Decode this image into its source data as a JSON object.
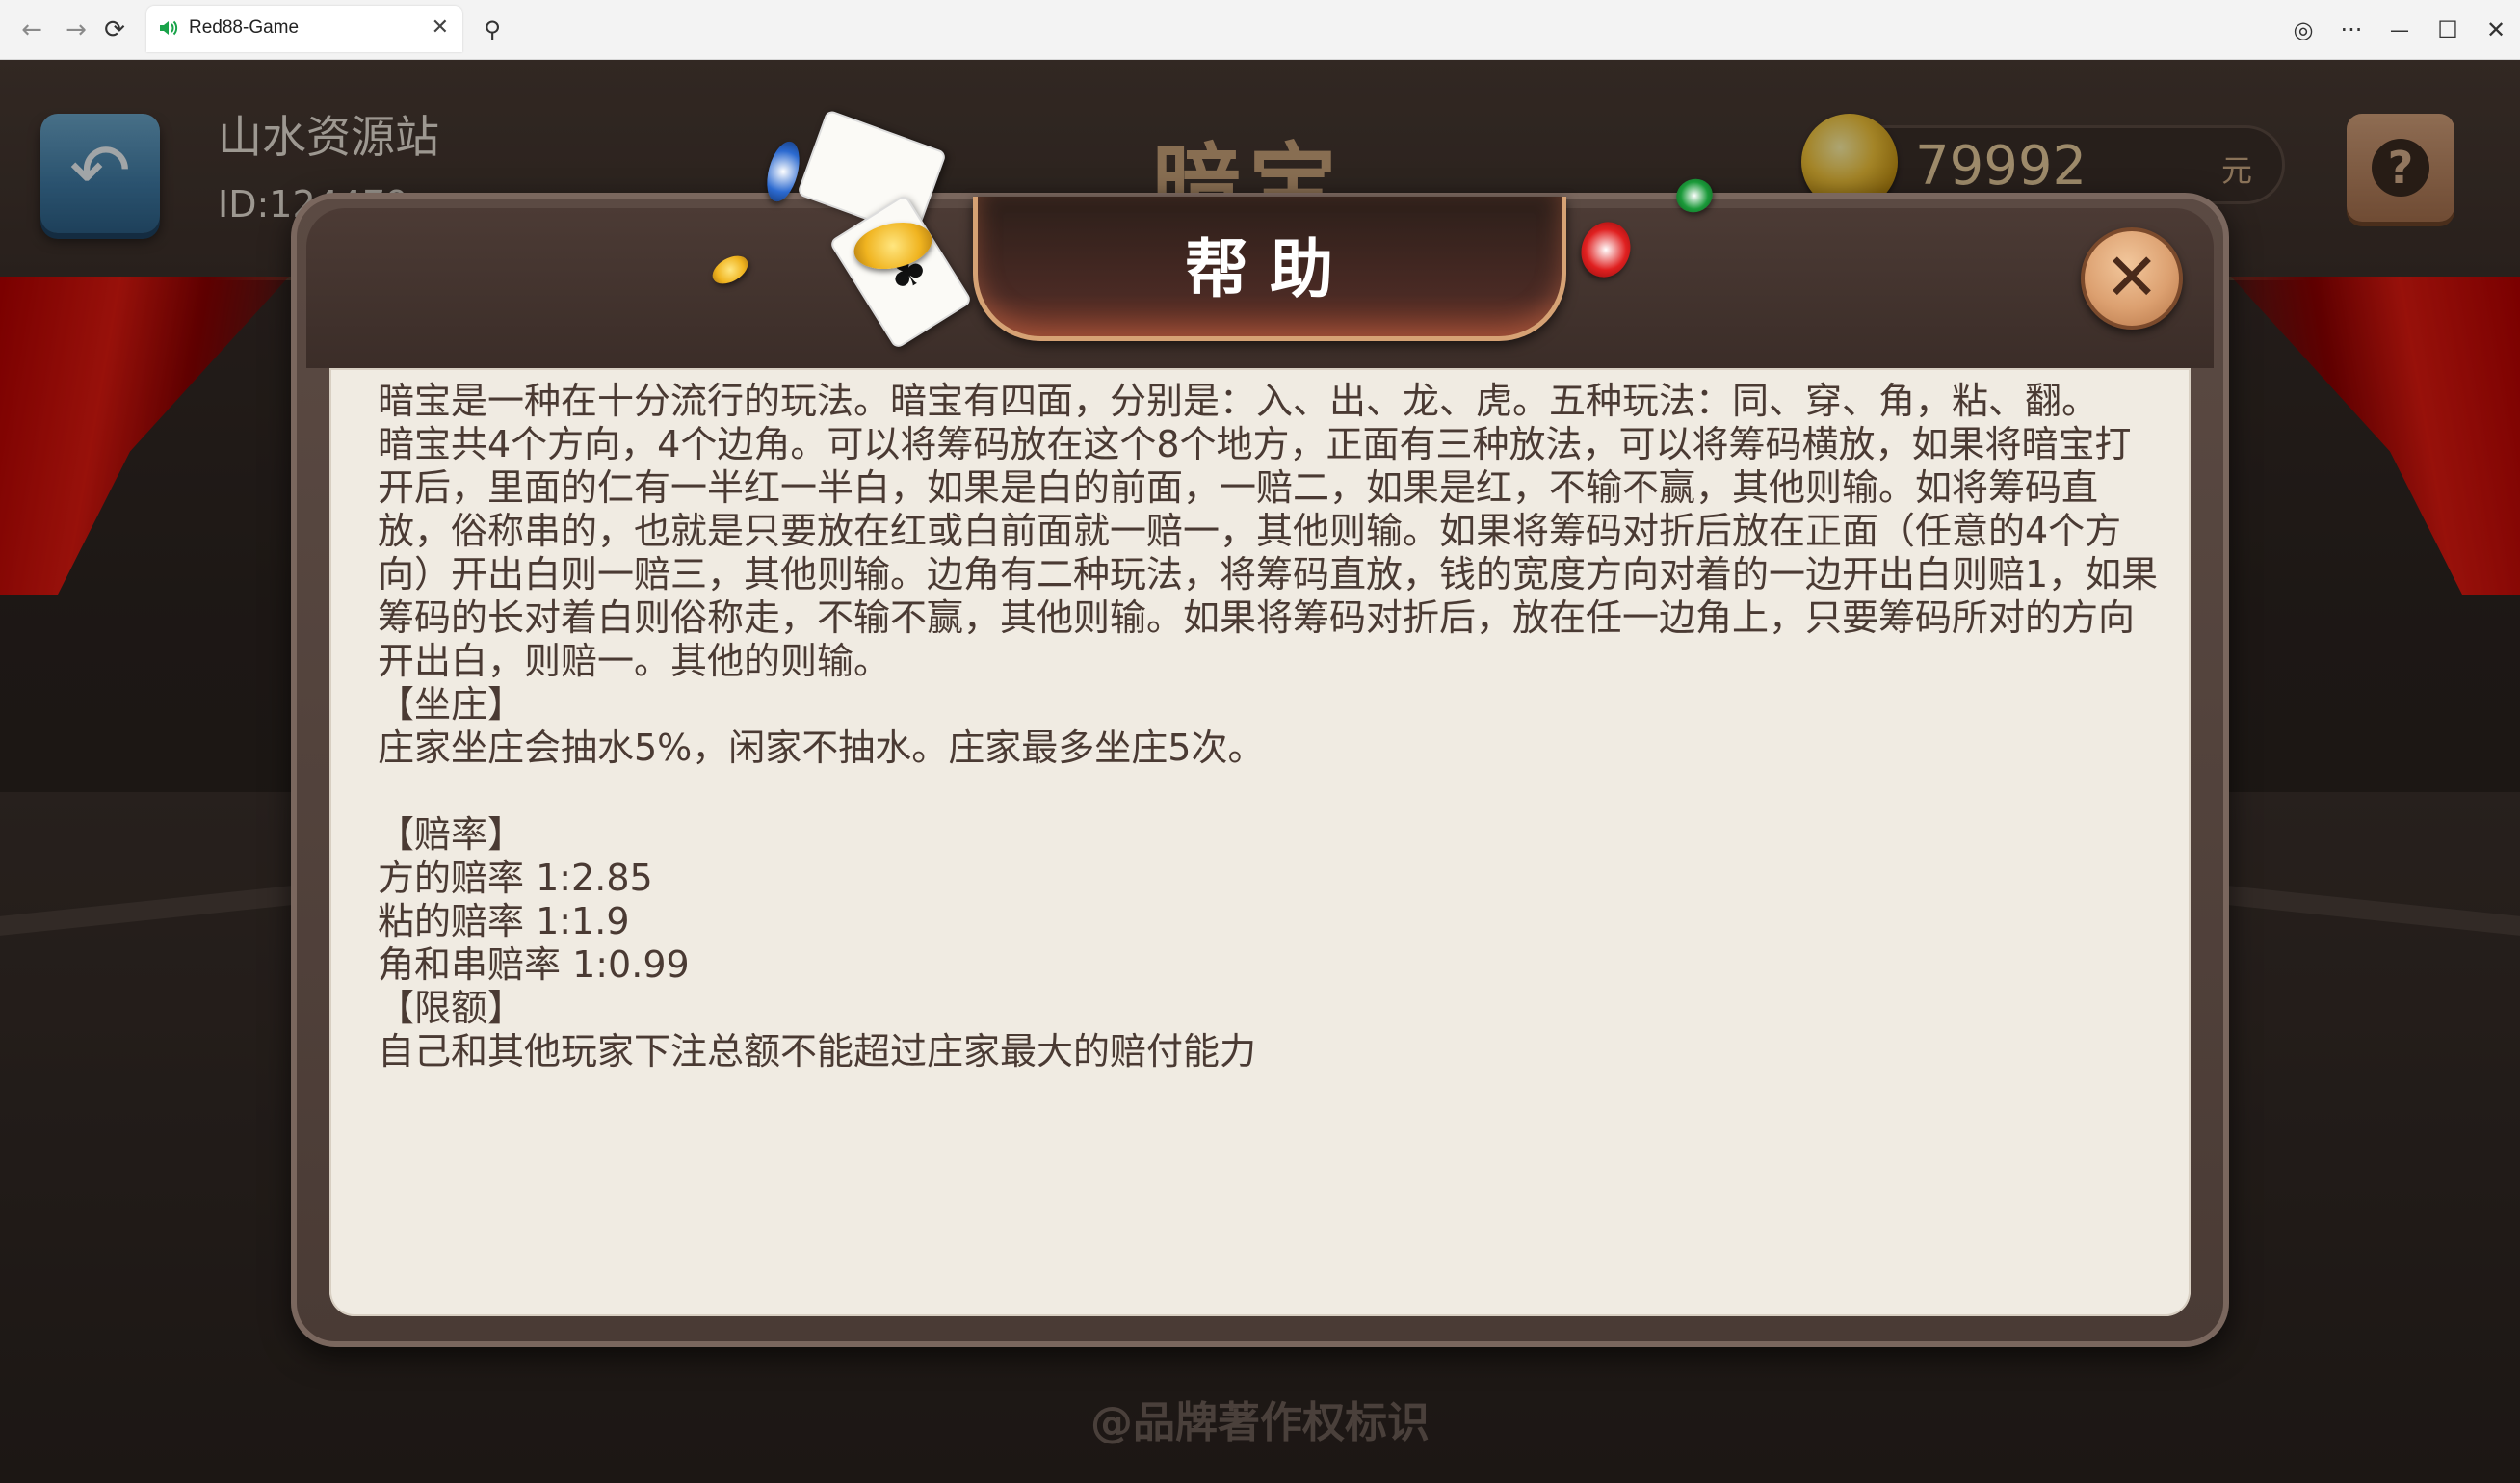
{
  "browser": {
    "tab_title": "Red88-Game",
    "back_glyph": "←",
    "forward_glyph": "→",
    "reload_glyph": "⟳",
    "search_glyph": "⚲",
    "close_tab_glyph": "✕",
    "globe_glyph": "◎",
    "more_glyph": "···",
    "minimize_glyph": "—",
    "maximize_glyph": "☐",
    "close_window_glyph": "✕"
  },
  "header": {
    "user_name": "山水资源站",
    "user_id": "ID:124479",
    "game_title": "暗宝",
    "coins": "79992",
    "coin_unit": "元",
    "back_icon": "undo-arrow-icon",
    "help_icon": "question-mark-icon"
  },
  "dialog": {
    "title": "帮助",
    "close_icon": "close-icon",
    "lines": [
      "暗宝是一种在十分流行的玩法。暗宝有四面，分别是：入、出、龙、虎。五种玩法：同、穿、角，粘、翻。",
      "暗宝共4个方向，4个边角。可以将筹码放在这个8个地方，正面有三种放法，可以将筹码横放，如果将暗宝打开后，里面的仁有一半红一半白，如果是白的前面，一赔二，如果是红，不输不赢，其他则输。如将筹码直放，俗称串的，也就是只要放在红或白前面就一赔一，其他则输。如果将筹码对折后放在正面（任意的4个方向）开出白则一赔三，其他则输。边角有二种玩法，将筹码直放，钱的宽度方向对着的一边开出白则赔1，如果筹码的长对着白则俗称走，不输不赢，其他则输。如果将筹码对折后，放在任一边角上，只要筹码所对的方向开出白，则赔一。其他的则输。",
      "【坐庄】",
      "庄家坐庄会抽水5%，闲家不抽水。庄家最多坐庄5次。",
      "",
      "【赔率】",
      "方的赔率 1:2.85",
      "粘的赔率 1:1.9",
      "角和串赔率 1:0.99",
      "【限额】",
      "自己和其他玩家下注总额不能超过庄家最大的赔付能力"
    ]
  },
  "footer": {
    "watermark": "@品牌著作权标识"
  },
  "colors": {
    "accent": "#d6a274",
    "panel": "#f0ebe2",
    "text": "#4a3a33",
    "curtain": "#d01010"
  }
}
